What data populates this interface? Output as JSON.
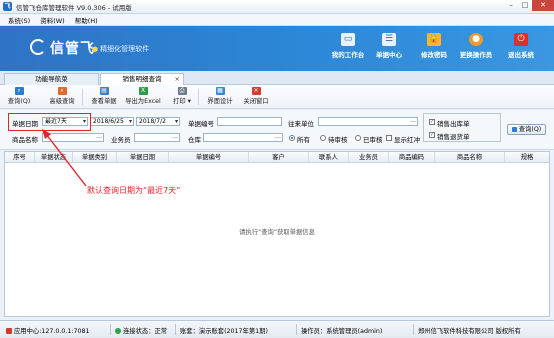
{
  "window": {
    "title": "信管飞仓库管理软件 V9.0.306 - 试用版",
    "buttons": {
      "minimize": "–",
      "maximize": "□",
      "close": "✕"
    }
  },
  "menu": {
    "items": [
      "系统(S)",
      "资料(W)",
      "帮助(H)"
    ]
  },
  "banner": {
    "logo": "信管飞",
    "slogan": "精细化管理软件",
    "nav": [
      {
        "label": "我的工作台",
        "icon": "monitor-icon",
        "color": "#2d6fbf"
      },
      {
        "label": "单据中心",
        "icon": "document-list-icon",
        "color": "#3069b5"
      },
      {
        "label": "修改密码",
        "icon": "lock-icon",
        "color": "#e0a321"
      },
      {
        "label": "更换操作员",
        "icon": "user-icon",
        "color": "#e38a1f"
      },
      {
        "label": "退出系统",
        "icon": "power-icon",
        "color": "#d6322c"
      }
    ]
  },
  "tabs": [
    {
      "label": "功能导航菜",
      "active": false
    },
    {
      "label": "销售明细查询",
      "active": true,
      "close": "×"
    }
  ],
  "toolbar": {
    "buttons": [
      {
        "label": "查询(Q)",
        "icon": "search-icon",
        "color": "#2c7bd0"
      },
      {
        "label": "高级查询",
        "icon": "advanced-search-icon",
        "color": "#e06a2b"
      },
      {
        "label": "查看单据",
        "icon": "view-document-icon",
        "color": "#3d7fc4"
      },
      {
        "label": "导出为Excel",
        "icon": "excel-export-icon",
        "color": "#2f9b46"
      },
      {
        "label": "打印",
        "icon": "print-icon",
        "color": "#6b7b8c"
      },
      {
        "label": "界面设计",
        "icon": "layout-design-icon",
        "color": "#3b86d6"
      },
      {
        "label": "关闭窗口",
        "icon": "close-window-icon",
        "color": "#d83b33"
      }
    ]
  },
  "filter": {
    "date_label": "单据日期",
    "date_range": "最近7天",
    "date_from": "2018/6/25",
    "date_to": "2018/7/2",
    "doc_no_label": "单据编号",
    "doc_no_value": "",
    "partner_label": "往来单位",
    "partner_value": "",
    "product_label": "商品名称",
    "product_value": "",
    "staff_label": "业务员",
    "staff_value": "",
    "warehouse_label": "仓库",
    "warehouse_value": "",
    "radio_options": [
      {
        "label": "所有",
        "checked": true
      },
      {
        "label": "待审核",
        "checked": false
      },
      {
        "label": "已审核",
        "checked": false
      }
    ],
    "show_red_label": "显示红冲",
    "show_red_checked": false,
    "check_sales_out": {
      "label": "销售出库单",
      "checked": true
    },
    "check_sales_return": {
      "label": "销售退货单",
      "checked": true
    },
    "query_button": "查询(Q)"
  },
  "grid": {
    "columns": [
      "序号",
      "单据状态",
      "单据类别",
      "单据日期",
      "单据编号",
      "客户",
      "联系人",
      "业务员",
      "商品编码",
      "商品名称",
      "规格"
    ],
    "empty_message": "请执行“查询”获取单据信息"
  },
  "annotation": "默认查询日期为“最近7天”",
  "status": {
    "app_center": "应用中心:127.0.0.1:7081",
    "connection": "连接状态：正常",
    "account_set": "账套：演示账套(2017年第1期)",
    "operator": "操作员：系统管理员(admin)",
    "company": "郑州信飞软件科技有限公司 版权所有"
  }
}
